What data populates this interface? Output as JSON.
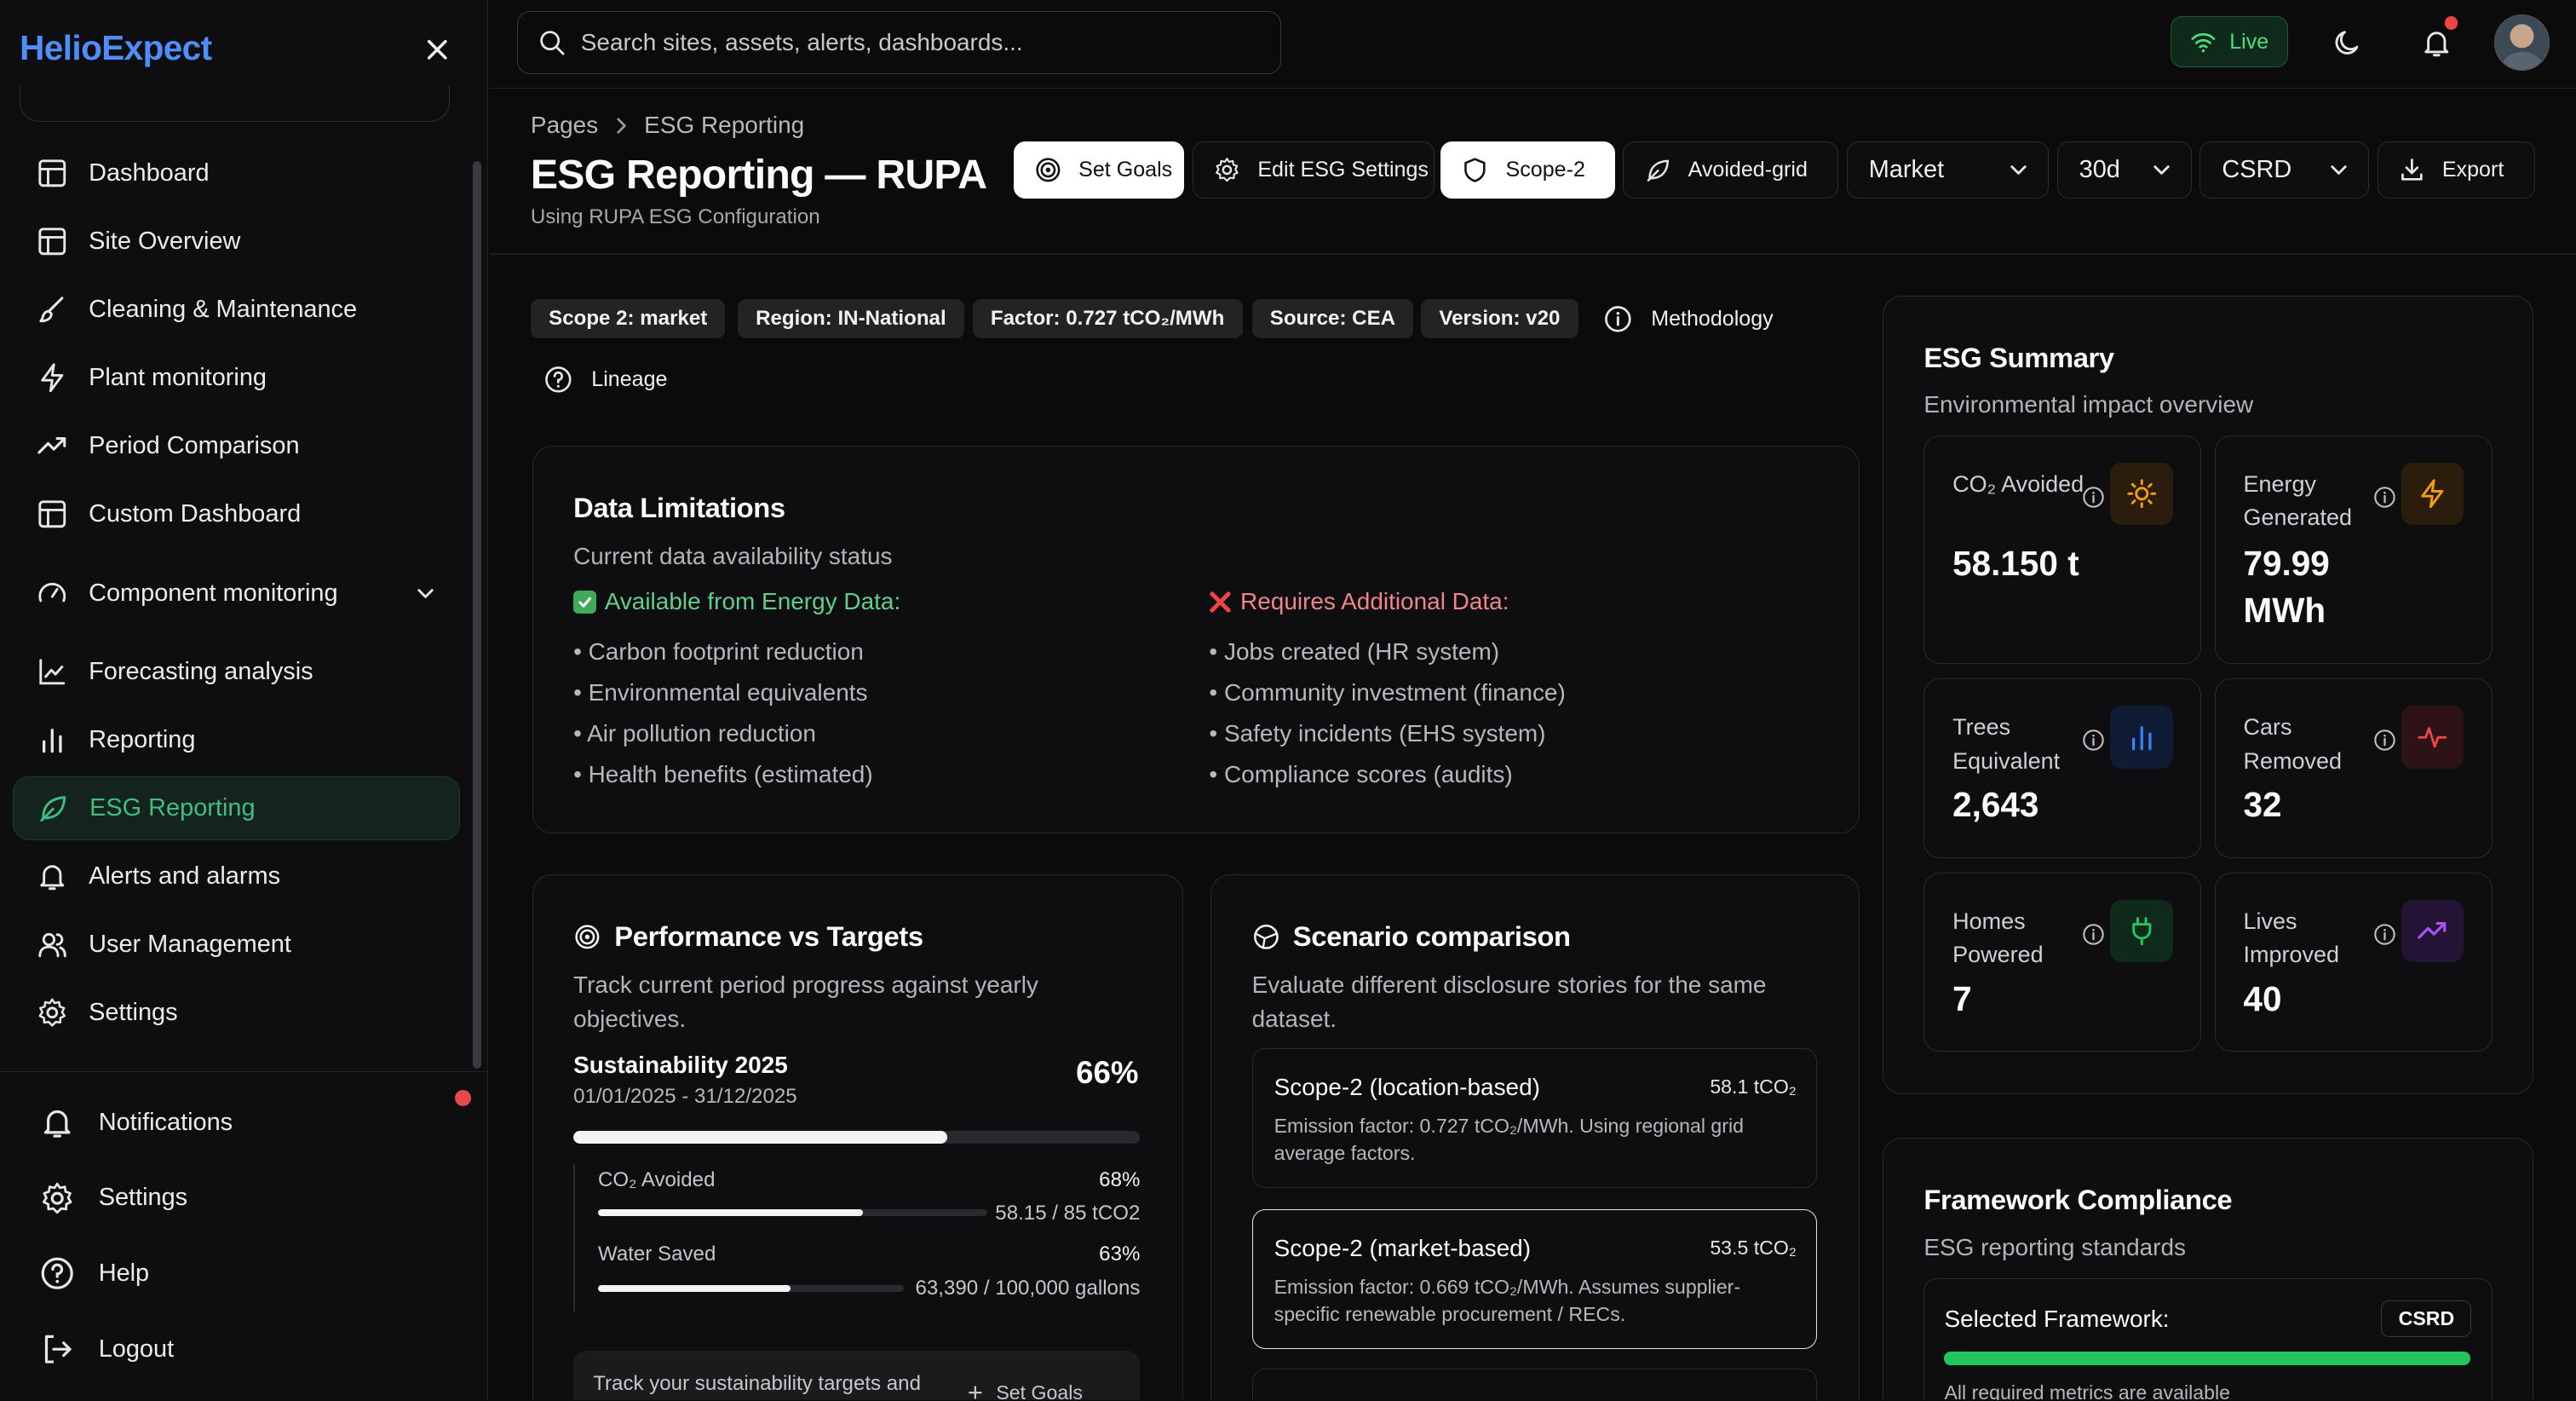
{
  "app": {
    "brand": "HelioExpect"
  },
  "search": {
    "placeholder": "Search sites, assets, alerts, dashboards..."
  },
  "topbar": {
    "live_label": "Live"
  },
  "sidebar": {
    "items": [
      {
        "label": "Dashboard",
        "icon": "layout-icon"
      },
      {
        "label": "Site Overview",
        "icon": "layout-icon"
      },
      {
        "label": "Cleaning & Maintenance",
        "icon": "brush-icon"
      },
      {
        "label": "Plant monitoring",
        "icon": "bolt-icon"
      },
      {
        "label": "Period Comparison",
        "icon": "trend-icon"
      },
      {
        "label": "Custom Dashboard",
        "icon": "layout-icon"
      },
      {
        "label": "Component monitoring",
        "icon": "gauge-icon"
      },
      {
        "label": "Forecasting analysis",
        "icon": "line-chart-icon"
      },
      {
        "label": "Reporting",
        "icon": "bar-chart-icon"
      },
      {
        "label": "ESG Reporting",
        "icon": "leaf-icon"
      },
      {
        "label": "Alerts and alarms",
        "icon": "bell-icon"
      },
      {
        "label": "User Management",
        "icon": "users-icon"
      },
      {
        "label": "Settings",
        "icon": "gear-icon"
      }
    ],
    "bottom": [
      {
        "label": "Notifications",
        "icon": "bell-icon"
      },
      {
        "label": "Settings",
        "icon": "gear-icon"
      },
      {
        "label": "Help",
        "icon": "help-icon"
      },
      {
        "label": "Logout",
        "icon": "logout-icon"
      }
    ]
  },
  "header": {
    "breadcrumb": [
      "Pages",
      "ESG Reporting"
    ],
    "title": "ESG Reporting — RUPA",
    "subtitle": "Using RUPA ESG Configuration",
    "buttons": {
      "set_goals": "Set Goals",
      "edit_settings": "Edit ESG Settings",
      "scope": "Scope-2",
      "avoided": "Avoided-grid",
      "export": "Export"
    },
    "selects": {
      "method": "Market",
      "period": "30d",
      "framework": "CSRD"
    }
  },
  "tags": [
    "Scope 2: market",
    "Region: IN-National",
    "Factor: 0.727 tCO₂/MWh",
    "Source: CEA",
    "Version: v20"
  ],
  "links": {
    "methodology": "Methodology",
    "lineage": "Lineage"
  },
  "limitations": {
    "title": "Data Limitations",
    "desc": "Current data availability status",
    "available_head": "Available from Energy Data:",
    "available": [
      "• Carbon footprint reduction",
      "• Environmental equivalents",
      "• Air pollution reduction",
      "• Health benefits (estimated)"
    ],
    "required_head": "Requires Additional Data:",
    "required": [
      "• Jobs created (HR system)",
      "• Community investment (finance)",
      "• Safety incidents (EHS system)",
      "• Compliance scores (audits)"
    ]
  },
  "performance": {
    "title": "Performance vs Targets",
    "desc": "Track current period progress against yearly objectives.",
    "goal_name": "Sustainability 2025",
    "goal_dates": "01/01/2025 - 31/12/2025",
    "goal_pct": "66%",
    "goal_progress": 0.66,
    "metrics": [
      {
        "label": "CO₂ Avoided",
        "pct": "68%",
        "value": "58.15 / 85 tCO2",
        "progress": 0.68
      },
      {
        "label": "Water Saved",
        "pct": "63%",
        "value": "63,390 / 100,000 gallons",
        "progress": 0.63
      }
    ],
    "prompt": "Track your sustainability targets and",
    "prompt_button": "Set Goals"
  },
  "scenario": {
    "title": "Scenario comparison",
    "desc": "Evaluate different disclosure stories for the same dataset.",
    "items": [
      {
        "title": "Scope-2 (location-based)",
        "value": "58.1 tCO₂",
        "desc": "Emission factor: 0.727 tCO₂/MWh. Using regional grid average factors."
      },
      {
        "title": "Scope-2 (market-based)",
        "value": "53.5 tCO₂",
        "desc": "Emission factor: 0.669 tCO₂/MWh. Assumes supplier-specific renewable procurement / RECs."
      }
    ]
  },
  "summary": {
    "title": "ESG Summary",
    "desc": "Environmental impact overview",
    "stats": [
      {
        "label": "CO₂ Avoided",
        "value": "58.150 t",
        "icon": "sun-icon",
        "color": "#f59e0b"
      },
      {
        "label": "Energy Generated",
        "value": "79.99 MWh",
        "icon": "bolt-icon",
        "color": "#f59e0b"
      },
      {
        "label": "Trees Equivalent",
        "value": "2,643",
        "icon": "bar-chart-icon",
        "color": "#3b82f6"
      },
      {
        "label": "Cars Removed",
        "value": "32",
        "icon": "pulse-icon",
        "color": "#ef4444"
      },
      {
        "label": "Homes Powered",
        "value": "7",
        "icon": "plug-icon",
        "color": "#22c55e"
      },
      {
        "label": "Lives Improved",
        "value": "40",
        "icon": "trend-icon",
        "color": "#a855f7"
      }
    ]
  },
  "compliance": {
    "title": "Framework Compliance",
    "desc": "ESG reporting standards",
    "selected_label": "Selected Framework:",
    "selected": "CSRD",
    "note": "All required metrics are available"
  }
}
